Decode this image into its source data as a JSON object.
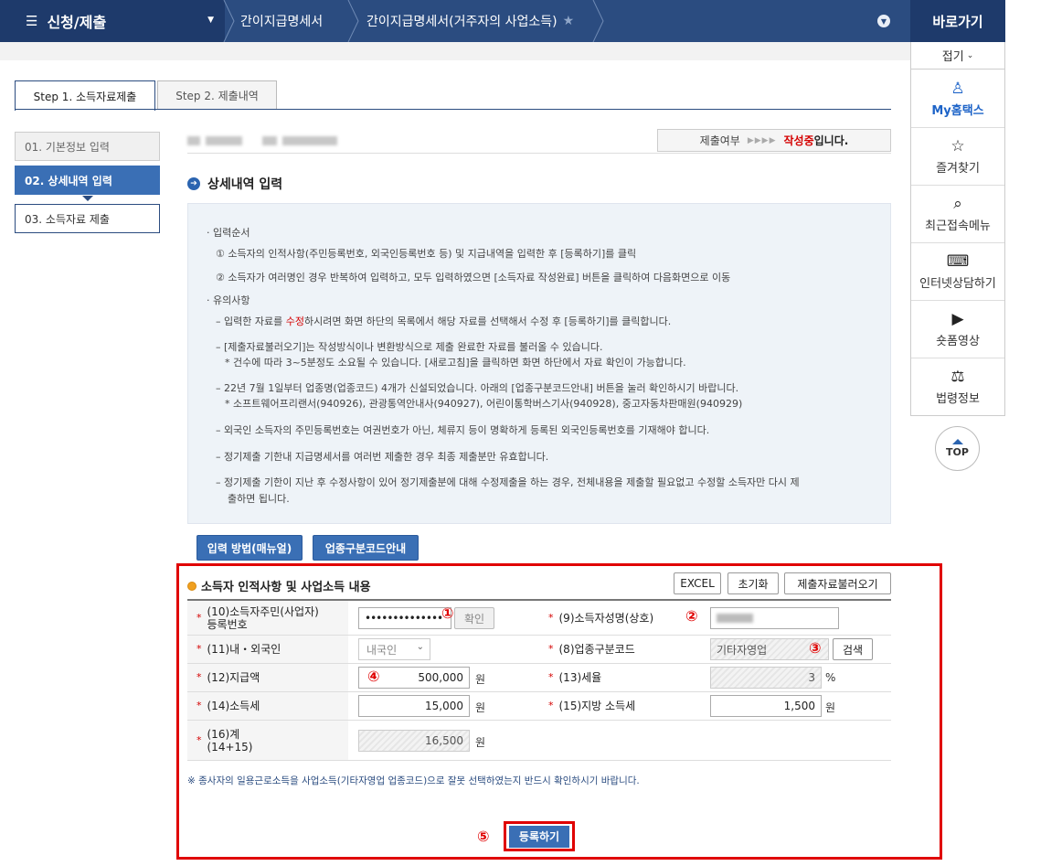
{
  "topbar": {
    "menu_label": "신청/제출",
    "breadcrumb1": "간이지급명세서",
    "breadcrumb2": "간이지급명세서(거주자의 사업소득)"
  },
  "quicklinks": {
    "title": "바로가기",
    "fold": "접기",
    "items": [
      {
        "icon": "person-icon",
        "glyph": "👤",
        "label": "My홈택스"
      },
      {
        "icon": "star-icon",
        "glyph": "☆",
        "label": "즐겨찾기"
      },
      {
        "icon": "recent-search-icon",
        "glyph": "🔍",
        "label": "최근접속메뉴"
      },
      {
        "icon": "laptop-icon",
        "glyph": "💻",
        "label": "인터넷상담하기"
      },
      {
        "icon": "play-icon",
        "glyph": "▶",
        "label": "숏폼영상"
      },
      {
        "icon": "gavel-icon",
        "glyph": "⚖",
        "label": "법령정보"
      }
    ],
    "top": "TOP"
  },
  "tabs": {
    "step1": "Step 1. 소득자료제출",
    "step2": "Step 2. 제출내역"
  },
  "steps": [
    "01. 기본정보 입력",
    "02. 상세내역 입력",
    "03. 소득자료 제출"
  ],
  "status": {
    "prefix": "제출여부",
    "arrows": "▶▶▶▶",
    "state": "작성중",
    "suffix": "입니다."
  },
  "section_title": "상세내역 입력",
  "guide": {
    "h1": "· 입력순서",
    "l1": "① 소득자의 인적사항(주민등록번호, 외국인등록번호 등) 및 지급내역을 입력한 후 [등록하기]를 클릭",
    "l2": "② 소득자가 여러명인 경우 반복하여 입력하고, 모두 입력하였으면 [소득자료 작성완료] 버튼을 클릭하여 다음화면으로 이동",
    "h2": "· 유의사항",
    "n1a": "– 입력한 자료를 ",
    "n1b": "수정",
    "n1c": "하시려면 화면 하단의 목록에서 해당 자료를 선택해서 수정 후 [등록하기]를 클릭합니다.",
    "n2": "– [제출자료불러오기]는 작성방식이나 변환방식으로 제출 완료한 자료를 불러올 수 있습니다.",
    "n2b": "* 건수에 따라 3~5분정도 소요될 수 있습니다. [새로고침]을 클릭하면 화면 하단에서 자료 확인이 가능합니다.",
    "n3": "– 22년 7월 1일부터 업종명(업종코드) 4개가 신설되었습니다. 아래의 [업종구분코드안내] 버튼을 눌러 확인하시기 바랍니다.",
    "n3b": "* 소프트웨어프리랜서(940926), 관광통역안내사(940927), 어린이통학버스기사(940928), 중고자동차판매원(940929)",
    "n4": "– 외국인 소득자의 주민등록번호는 여권번호가 아닌, 체류지 등이 명확하게 등록된 외국인등록번호를 기재해야 합니다.",
    "n5": "– 정기제출 기한내 지급명세서를 여러번 제출한 경우 최종 제출분만 유효합니다.",
    "n6": "– 정기제출 기한이 지난 후 수정사항이 있어 정기제출분에 대해 수정제출을 하는 경우, 전체내용을 제출할 필요없고 수정할 소득자만 다시 제",
    "n6b": "출하면 됩니다."
  },
  "buttons": {
    "method": "입력 방법(매뉴얼)",
    "code_guide": "업종구분코드안내",
    "excel": "EXCEL",
    "reset": "초기화",
    "load": "제출자료불러오기",
    "confirm": "확인",
    "search": "검색",
    "submit": "등록하기"
  },
  "form": {
    "title": "소득자 인적사항 및 사업소득 내용",
    "star": "*",
    "l10a": "(10)소득자주민(사업자)",
    "l10b": "등록번호",
    "v10": "••••••••••••••",
    "l9": "(9)소득자성명(상호)",
    "l11": "(11)내・외국인",
    "v11": "내국인",
    "l8": "(8)업종구분코드",
    "v8": "기타자영업",
    "l12": "(12)지급액",
    "v12": "500,000",
    "l13": "(13)세율",
    "v13": "3",
    "l14": "(14)소득세",
    "v14": "15,000",
    "l15": "(15)지방 소득세",
    "v15": "1,500",
    "l16a": "(16)계",
    "l16b": "(14+15)",
    "v16": "16,500",
    "won": "원",
    "pct": "%"
  },
  "note": "※ 종사자의 일용근로소득을 사업소득(기타자영업 업종코드)으로 잘못 선택하였는지 반드시 확인하시기 바랍니다.",
  "markers": [
    "①",
    "②",
    "③",
    "④",
    "⑤"
  ],
  "colors": {
    "navy": "#2b4c80",
    "blue": "#3a6fb5",
    "red": "#e00000"
  }
}
